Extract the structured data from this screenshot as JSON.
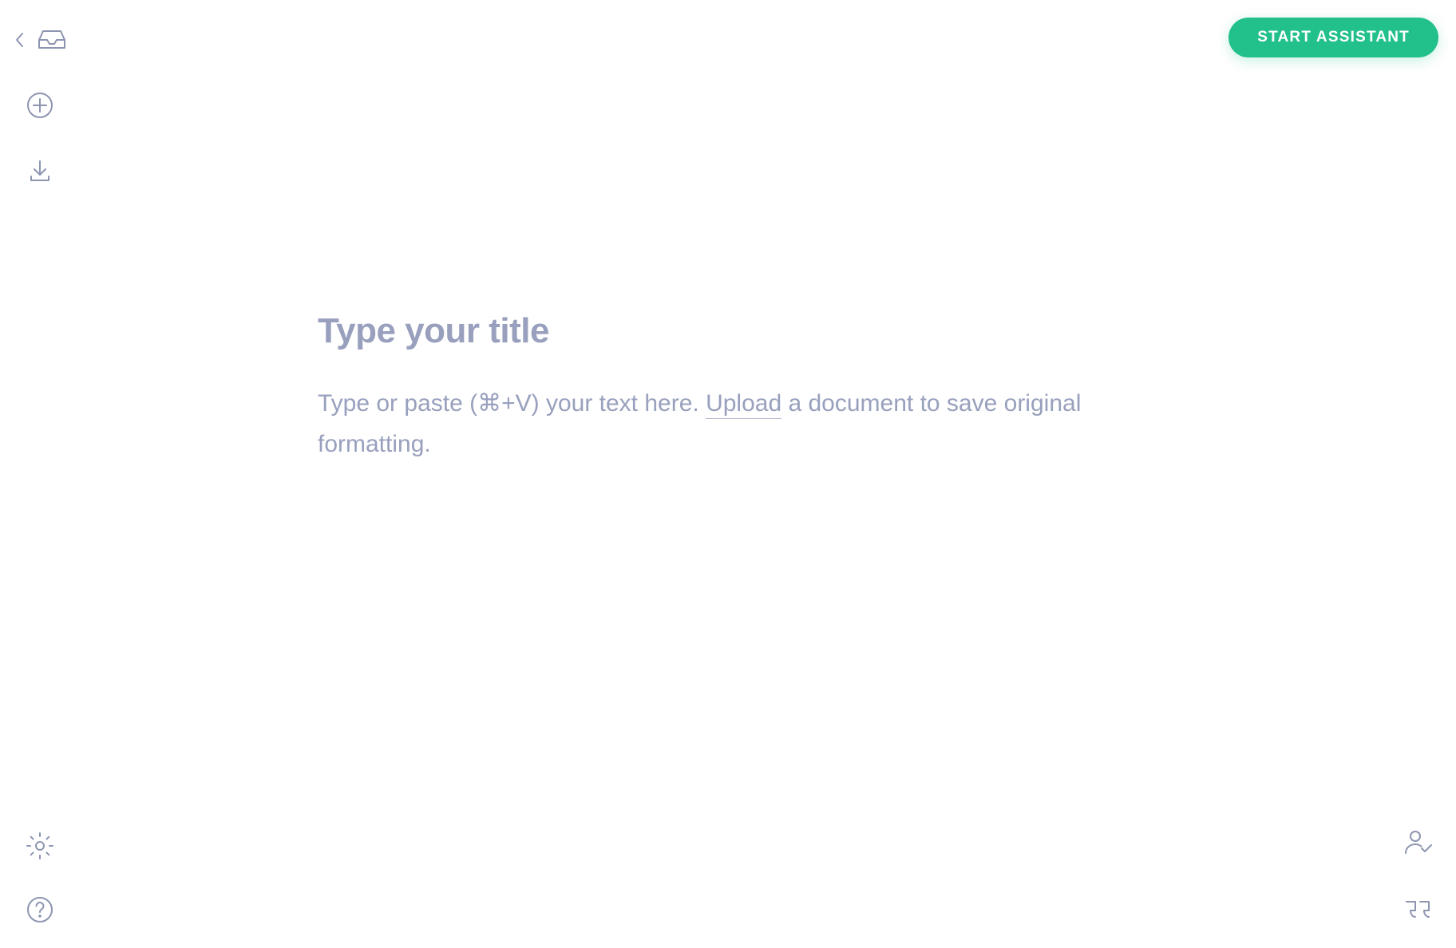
{
  "header": {
    "start_assistant_label": "START ASSISTANT"
  },
  "editor": {
    "title_placeholder": "Type your title",
    "body_prefix": "Type or paste (⌘+V) your text here. ",
    "upload_link_text": "Upload",
    "body_suffix": " a document to save original formatting."
  },
  "toolbar_left": {
    "back": "back",
    "inbox": "inbox",
    "add": "add",
    "download": "download",
    "settings": "settings",
    "help": "help"
  },
  "toolbar_right": {
    "user_check": "user-check",
    "quote": "quote"
  }
}
